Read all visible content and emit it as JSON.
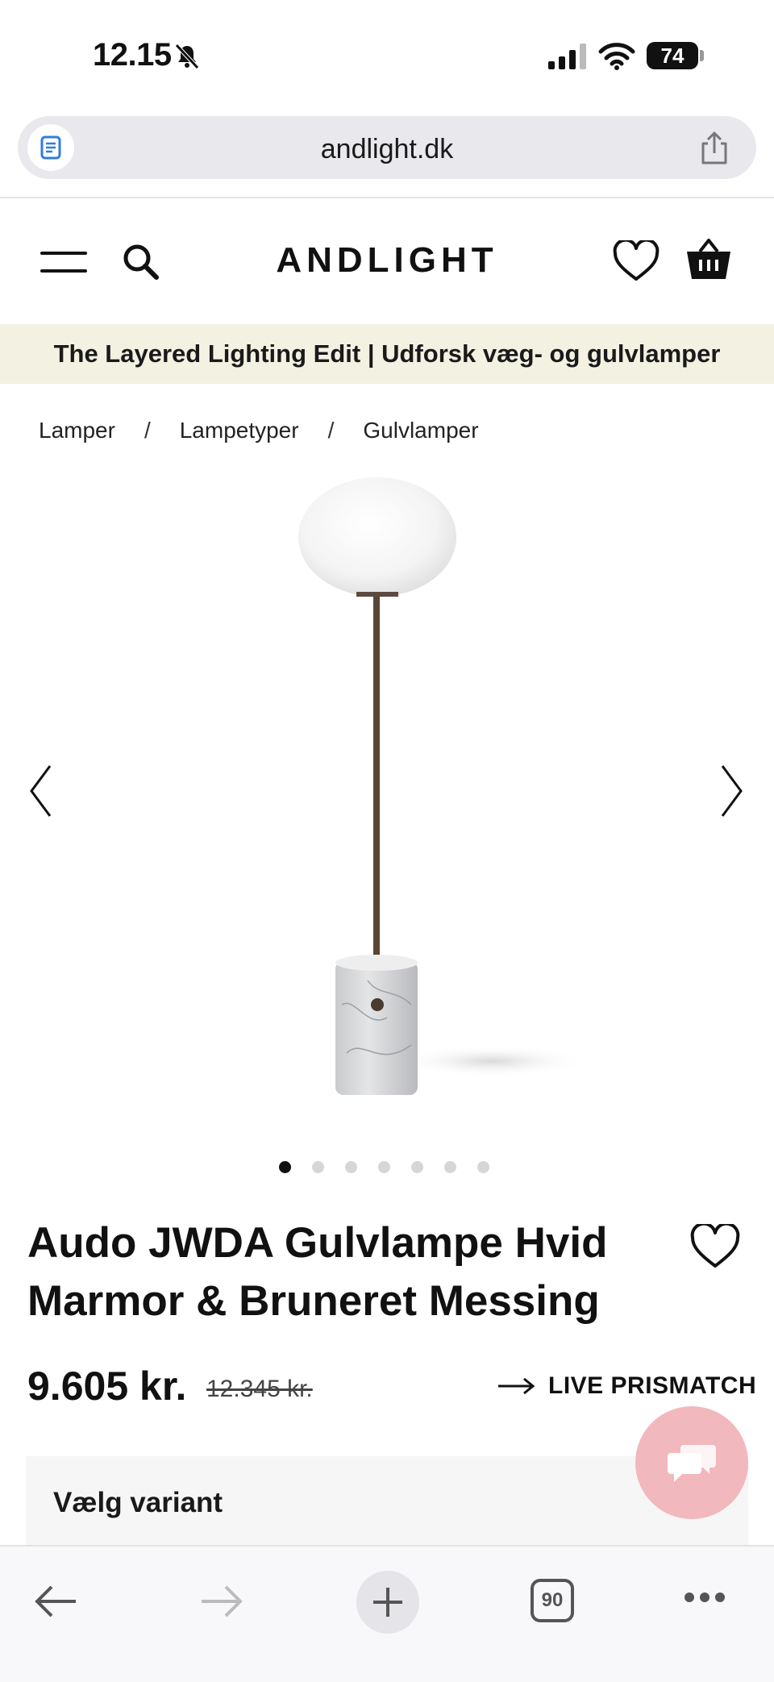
{
  "status_bar": {
    "time": "12.15",
    "battery": "74"
  },
  "browser": {
    "url": "andlight.dk",
    "tab_count": "90"
  },
  "header": {
    "logo": "ANDLIGHT"
  },
  "promo": {
    "text": "The Layered Lighting Edit | Udforsk væg- og gulvlamper"
  },
  "breadcrumb": {
    "items": [
      "Lamper",
      "Lampetyper",
      "Gulvlamper"
    ],
    "separator": "/"
  },
  "gallery": {
    "slide_count": 7,
    "active_index": 0
  },
  "product": {
    "title": "Audo JWDA Gulvlampe Hvid Marmor & Bruneret Messing",
    "price": "9.605 kr.",
    "old_price": "12.345 kr.",
    "price_match_label": "LIVE PRISMATCH",
    "variant_label": "Vælg variant"
  },
  "colors": {
    "promo_bg": "#f3f1e2",
    "chat_bubble": "#f1b8bd",
    "text": "#111111"
  },
  "icons": [
    "bell-slash-icon",
    "signal-icon",
    "wifi-icon",
    "battery-icon",
    "reader-icon",
    "share-icon",
    "menu-icon",
    "search-icon",
    "heart-icon",
    "basket-icon",
    "chevron-left-icon",
    "chevron-right-icon",
    "arrow-right-icon",
    "chat-icon",
    "back-icon",
    "forward-icon",
    "plus-icon",
    "more-icon"
  ]
}
